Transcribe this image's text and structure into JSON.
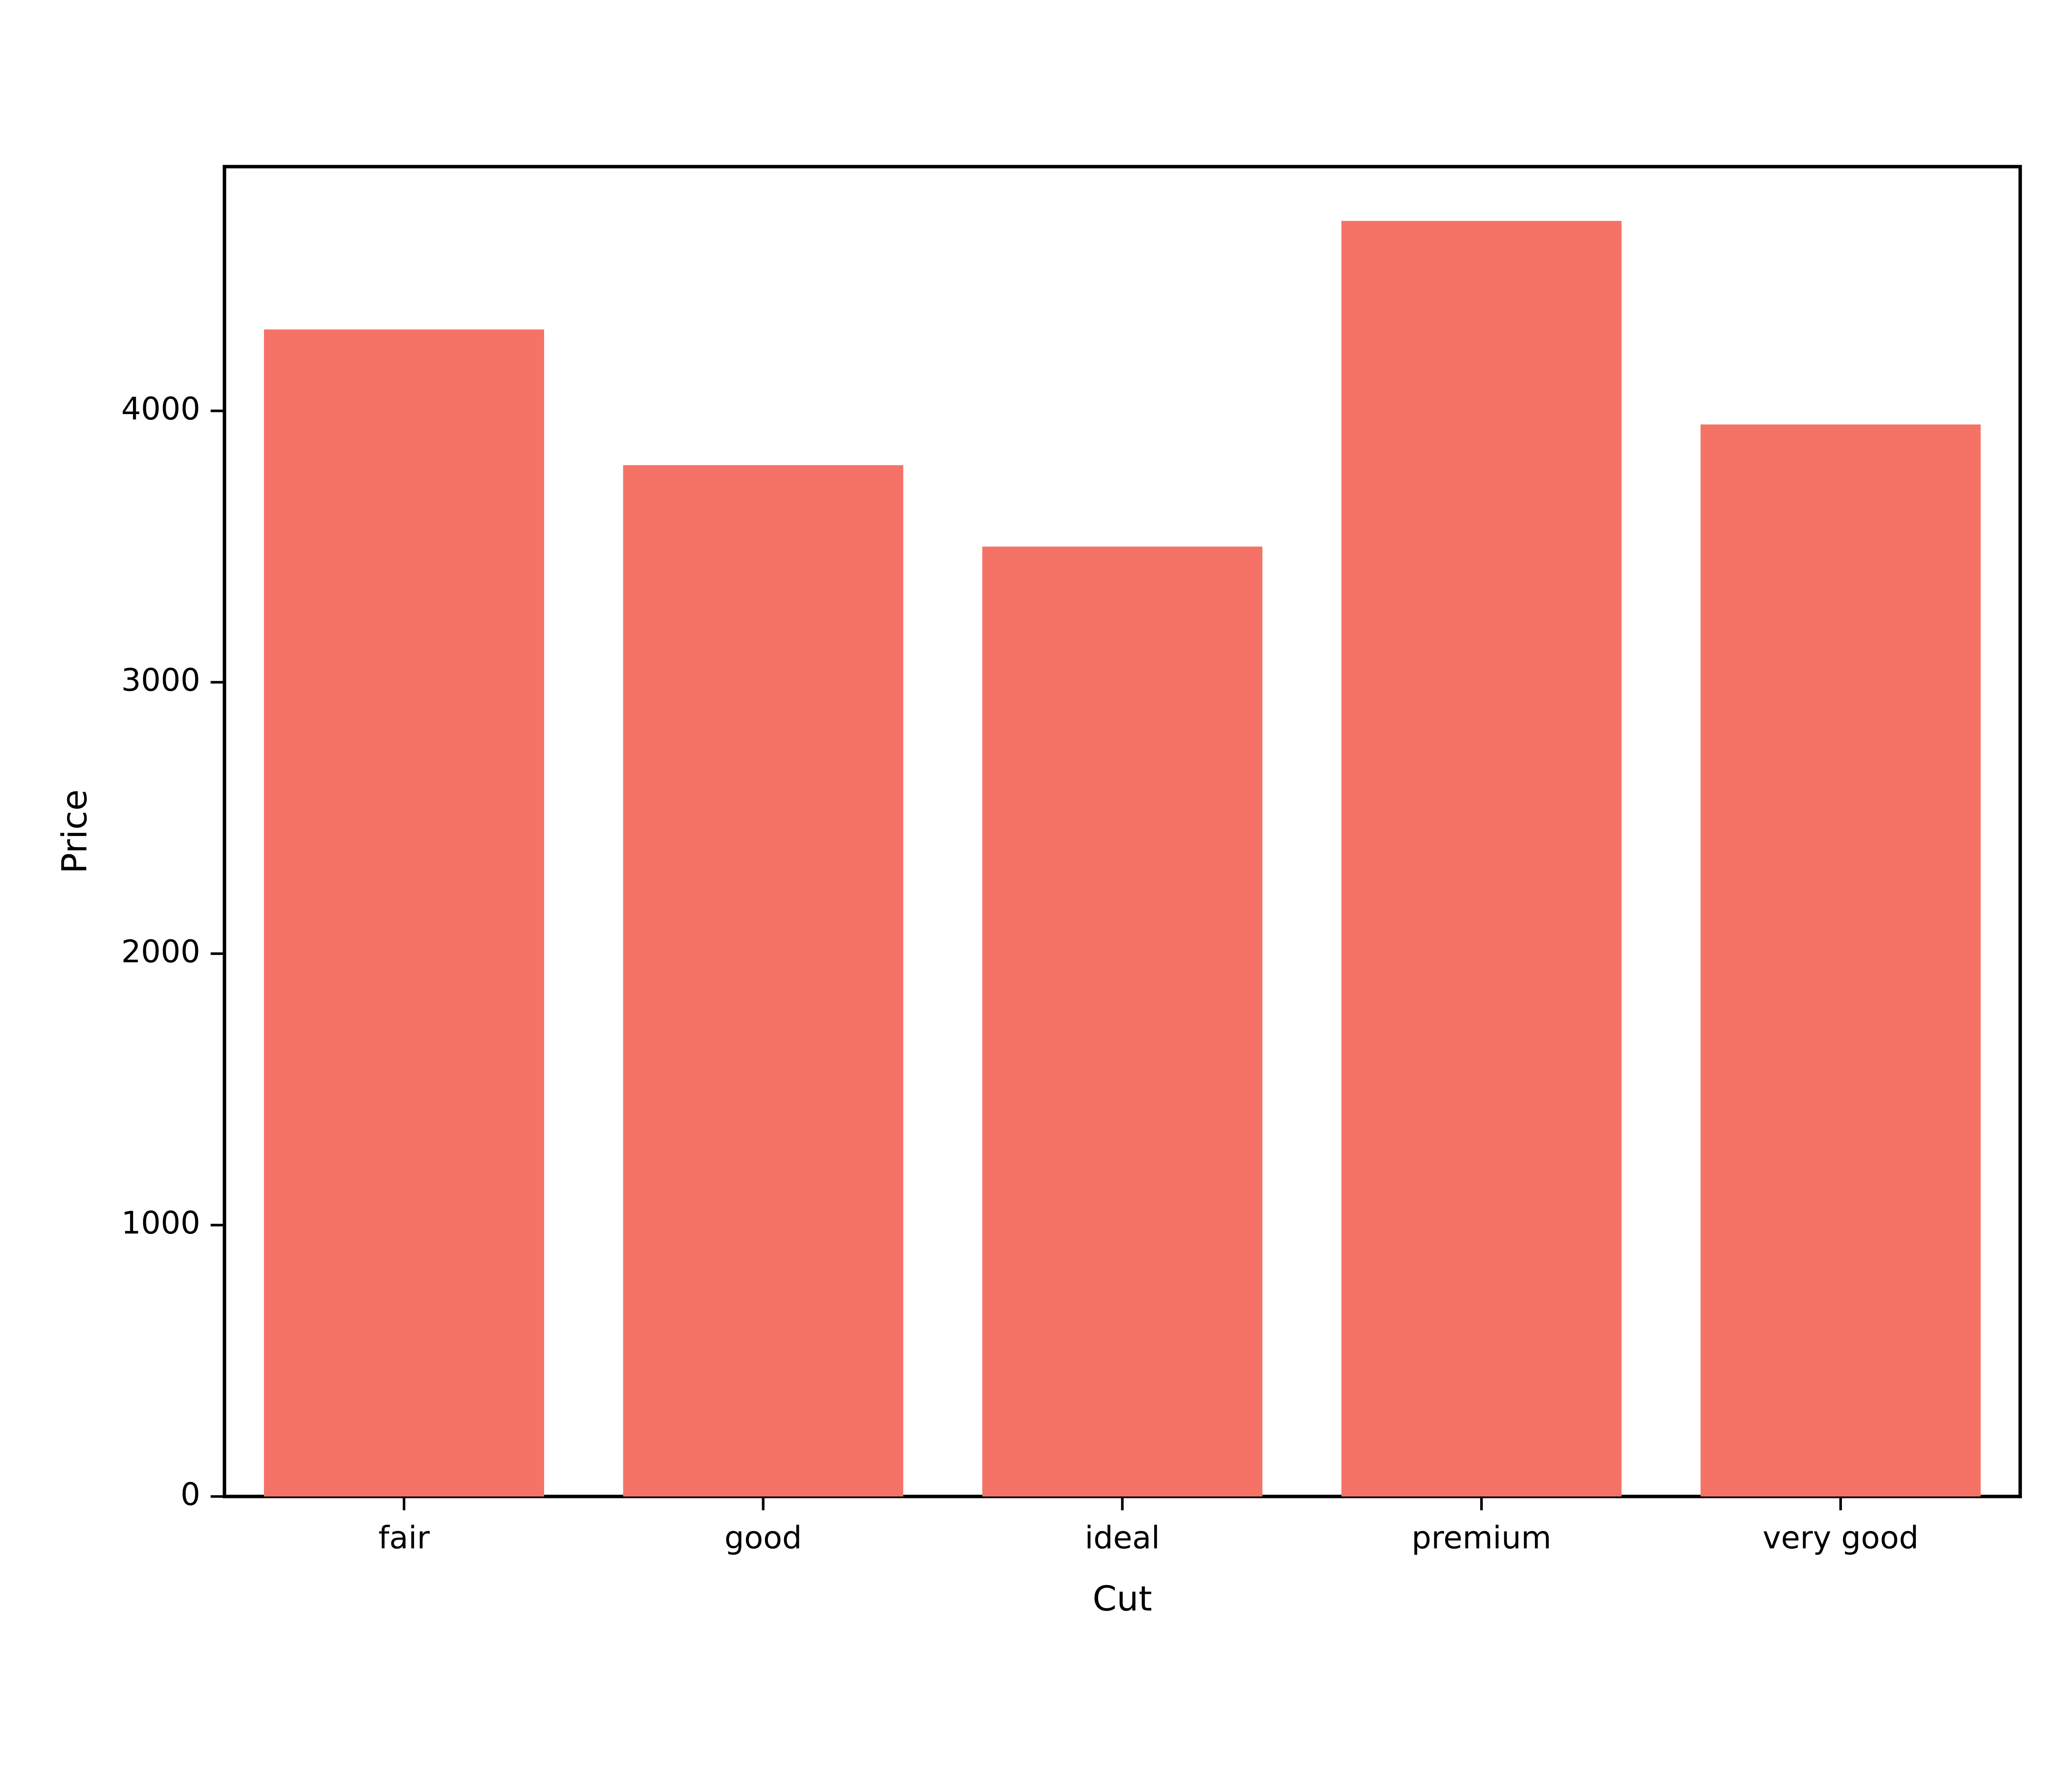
{
  "chart_data": {
    "type": "bar",
    "categories": [
      "fair",
      "good",
      "ideal",
      "premium",
      "very good"
    ],
    "values": [
      4300,
      3800,
      3500,
      4700,
      3950
    ],
    "title": "",
    "xlabel": "Cut",
    "ylabel": "Price",
    "ylim": [
      0,
      4900
    ],
    "yticks": [
      0,
      1000,
      2000,
      3000,
      4000
    ],
    "bar_color": "#f47366"
  },
  "watermark": ""
}
